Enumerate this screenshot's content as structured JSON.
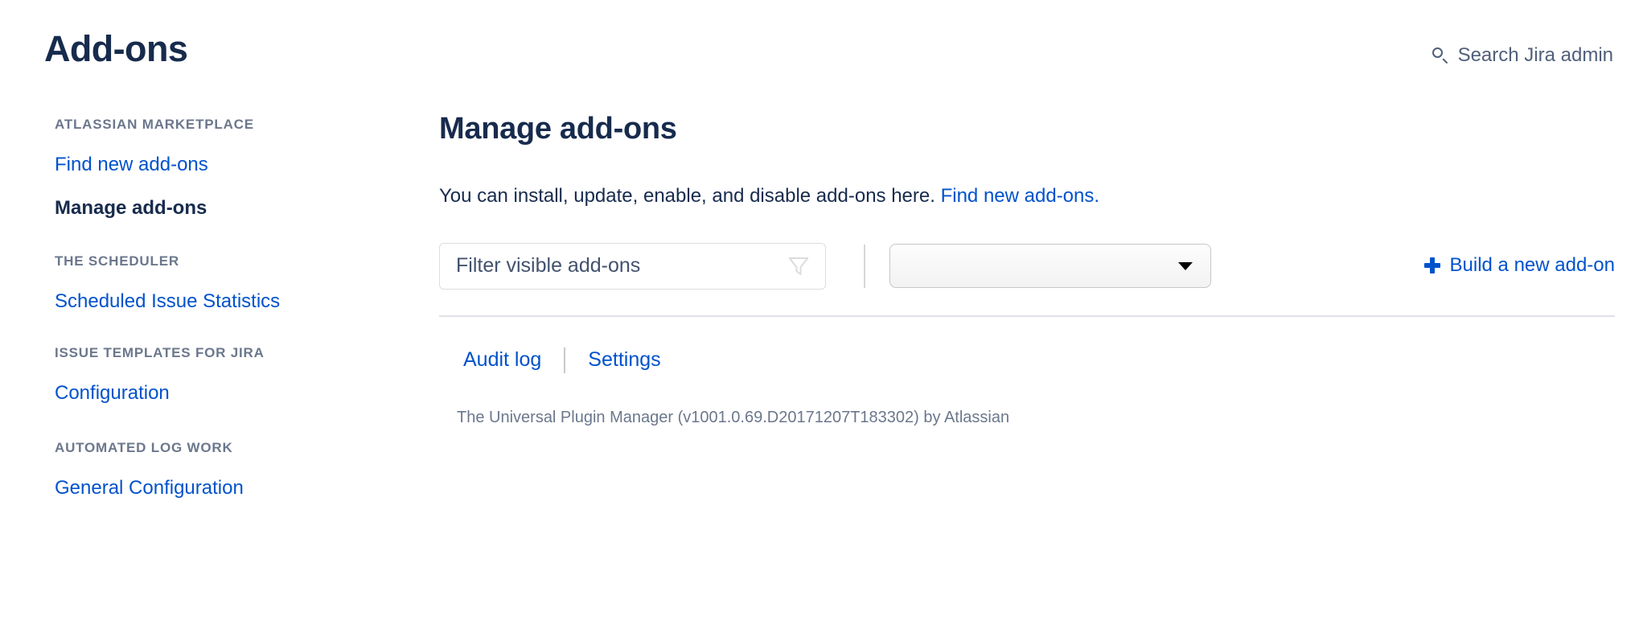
{
  "header": {
    "title": "Add-ons",
    "search": {
      "label": "Search Jira admin",
      "icon": "search-icon"
    }
  },
  "sidebar": {
    "sections": [
      {
        "heading": "ATLASSIAN MARKETPLACE",
        "items": [
          {
            "label": "Find new add-ons",
            "active": false
          },
          {
            "label": "Manage add-ons",
            "active": true
          }
        ]
      },
      {
        "heading": "THE SCHEDULER",
        "items": [
          {
            "label": "Scheduled Issue Statistics",
            "active": false
          }
        ]
      },
      {
        "heading": "ISSUE TEMPLATES FOR JIRA",
        "items": [
          {
            "label": "Configuration",
            "active": false
          }
        ]
      },
      {
        "heading": "AUTOMATED LOG WORK",
        "items": [
          {
            "label": "General Configuration",
            "active": false
          }
        ]
      }
    ]
  },
  "main": {
    "title": "Manage add-ons",
    "description_text": "You can install, update, enable, and disable add-ons here.",
    "description_link": "Find new add-ons.",
    "filter": {
      "placeholder": "Filter visible add-ons",
      "value": "",
      "icon": "funnel-icon"
    },
    "category_select": {
      "value": "",
      "icon": "chevron-down-icon"
    },
    "build_link": {
      "label": "Build a new add-on",
      "icon": "plus-icon"
    },
    "tabs": [
      {
        "label": "Audit log"
      },
      {
        "label": "Settings"
      }
    ],
    "footer": "The Universal Plugin Manager (v1001.0.69.D20171207T183302) by Atlassian"
  },
  "colors": {
    "link": "#0052CC",
    "text_dark": "#172B4D",
    "text_muted": "#6B778C",
    "border": "#DFE1E6"
  }
}
